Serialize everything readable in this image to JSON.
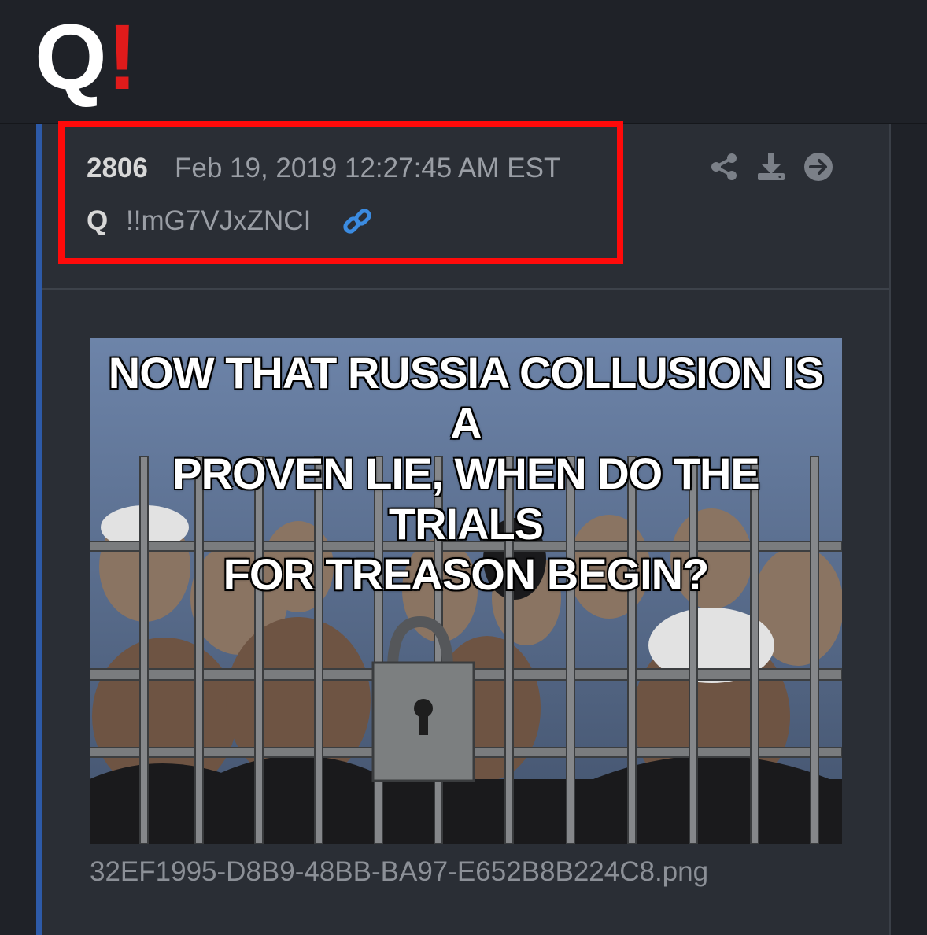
{
  "logo": {
    "letter": "Q",
    "mark": "!",
    "mark_color": "#e01b1b"
  },
  "post": {
    "number": "2806",
    "timestamp": "Feb 19, 2019 12:27:45 AM EST",
    "author": "Q",
    "tripcode": "!!mG7VJxZNCI",
    "link_icon": "link-icon",
    "actions": [
      {
        "icon": "share-icon"
      },
      {
        "icon": "download-icon"
      },
      {
        "icon": "arrow-right-circle-icon"
      }
    ],
    "image": {
      "caption_lines": [
        "NOW THAT RUSSIA COLLUSION IS A",
        "PROVEN LIE, WHEN DO THE TRIALS",
        "FOR TREASON BEGIN?"
      ]
    },
    "filename": "32EF1995-D8B9-48BB-BA97-E652B8B224C8.png"
  },
  "colors": {
    "accent_border": "#2d5aa8",
    "highlight": "#ff0a0a",
    "background": "#1f2228",
    "panel": "#2a2e35"
  }
}
